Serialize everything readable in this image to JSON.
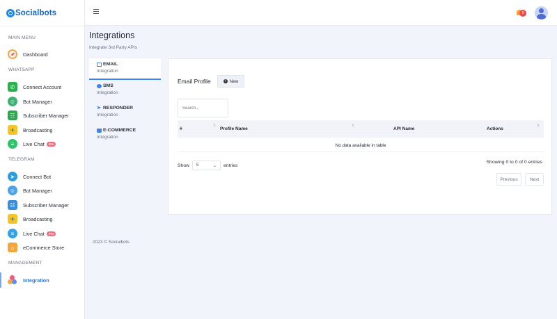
{
  "brand": {
    "name": "Socialbots"
  },
  "sidebar": {
    "sections": [
      {
        "label": "MAIN MENU"
      },
      {
        "label": "WHATSAPP"
      },
      {
        "label": "TELEGRAM"
      },
      {
        "label": "MANAGEMENT"
      }
    ],
    "items": [
      {
        "label": "Dashboard"
      },
      {
        "label": "Connect Account"
      },
      {
        "label": "Bot Manager"
      },
      {
        "label": "Subscriber Manager"
      },
      {
        "label": "Broadcasting"
      },
      {
        "label": "Live Chat",
        "badge": "Pro"
      },
      {
        "label": "Connect Bot"
      },
      {
        "label": "Bot Manager"
      },
      {
        "label": "Subscriber Manager"
      },
      {
        "label": "Broadcasting"
      },
      {
        "label": "Live Chat",
        "badge": "Pro"
      },
      {
        "label": "eCommerce Store"
      },
      {
        "label": "Integration"
      }
    ]
  },
  "topbar": {
    "notification_count": "5"
  },
  "page": {
    "title": "Integrations",
    "subtitle": "Integrate 3rd Party APIs"
  },
  "integration_tabs": [
    {
      "title": "EMAIL",
      "sub": "Integration"
    },
    {
      "title": "SMS",
      "sub": "Integration"
    },
    {
      "title": "RESPONDER",
      "sub": "Integration"
    },
    {
      "title": "E-COMMERCE",
      "sub": "Integration"
    }
  ],
  "card": {
    "title": "Email Profile",
    "new_button": "New",
    "search_placeholder": "Search...",
    "columns": [
      "#",
      "Profile Name",
      "API Name",
      "Actions"
    ],
    "empty_message": "No data available in table",
    "show_label": "Show",
    "page_size": "5",
    "entries_label": "entries",
    "showing_text": "Showing 0 to 0 of 0 entries",
    "prev_label": "Previous",
    "next_label": "Next"
  },
  "footer": {
    "text": "2023 © Socialbots"
  },
  "colors": {
    "accent": "#2f78e8",
    "brand": "#1565c0",
    "pro_badge": "#f36b7f",
    "notification": "#ef4a4a"
  }
}
